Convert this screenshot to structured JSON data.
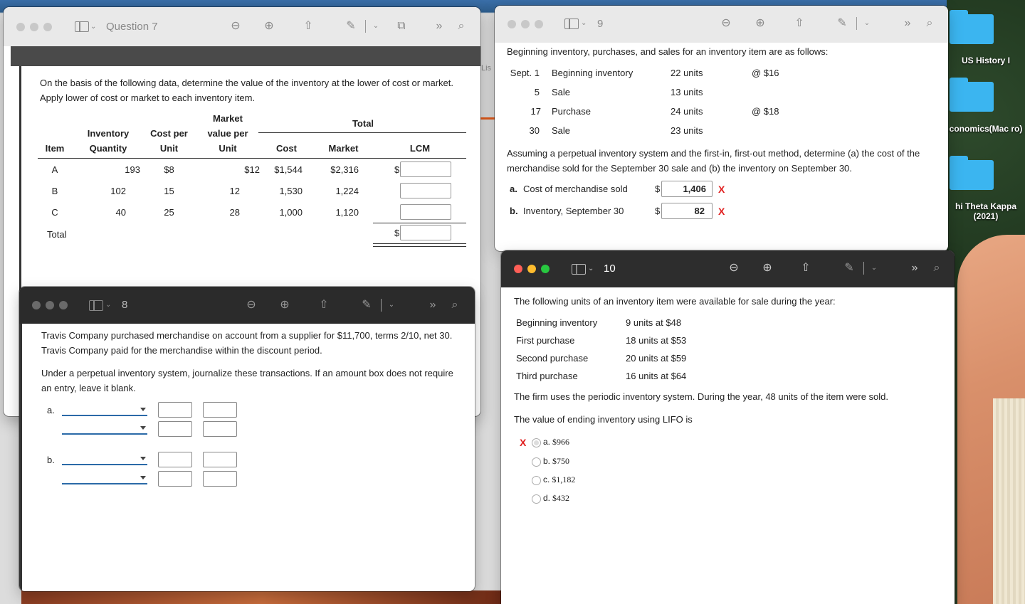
{
  "desktop": {
    "folders": [
      {
        "label": "US History I"
      },
      {
        "label": "conomics(Mac ro)"
      },
      {
        "label": "hi Theta Kappa (2021)"
      }
    ]
  },
  "partial_label": "Lis",
  "win7": {
    "title": "Question 7",
    "prompt": "On the basis of the following data, determine the value of the inventory at the lower of cost or market. Apply lower of cost or market to each inventory item.",
    "headers": {
      "market_top": "Market",
      "total": "Total",
      "inventory": "Inventory",
      "cost_per": "Cost per",
      "value_per": "value per",
      "item": "Item",
      "quantity": "Quantity",
      "unit": "Unit",
      "unit2": "Unit",
      "cost": "Cost",
      "market": "Market",
      "lcm": "LCM"
    },
    "rows": [
      {
        "item": "A",
        "qty": "193",
        "cost_per": "$8",
        "market_per": "$12",
        "cost": "$1,544",
        "market": "$2,316",
        "dollar": "$"
      },
      {
        "item": "B",
        "qty": "102",
        "cost_per": "15",
        "market_per": "12",
        "cost": "1,530",
        "market": "1,224",
        "dollar": ""
      },
      {
        "item": "C",
        "qty": "40",
        "cost_per": "25",
        "market_per": "28",
        "cost": "1,000",
        "market": "1,120",
        "dollar": ""
      }
    ],
    "total_label": "Total",
    "total_dollar": "$"
  },
  "win8": {
    "title": "8",
    "p1": "Travis Company purchased merchandise on account from a supplier for $11,700, terms 2/10, net 30. Travis Company paid for the merchandise within the discount period.",
    "p2": "Under a perpetual inventory system, journalize these transactions. If an amount box does not require an entry, leave it blank.",
    "label_a": "a.",
    "label_b": "b."
  },
  "win9": {
    "title": "9",
    "intro": "Beginning inventory, purchases, and sales for an inventory item are as follows:",
    "rows": [
      {
        "date": "Sept. 1",
        "desc": "Beginning inventory",
        "units": "22 units",
        "price": "@ $16"
      },
      {
        "date": "5",
        "desc": "Sale",
        "units": "13 units",
        "price": ""
      },
      {
        "date": "17",
        "desc": "Purchase",
        "units": "24 units",
        "price": "@ $18"
      },
      {
        "date": "30",
        "desc": "Sale",
        "units": "23 units",
        "price": ""
      }
    ],
    "question": "Assuming a perpetual inventory system and the first-in, first-out method, determine (a) the cost of the merchandise sold for the September 30 sale and (b) the inventory on September 30.",
    "a_label": "a.",
    "a_text": "Cost of merchandise sold",
    "a_value": "1,406",
    "b_label": "b.",
    "b_text": "Inventory, September 30",
    "b_value": "82",
    "dollar": "$",
    "wrong_mark": "X"
  },
  "win10": {
    "title": "10",
    "intro": "The following units of an inventory item were available for sale during the year:",
    "rows": [
      {
        "label": "Beginning inventory",
        "value": "9 units at $48"
      },
      {
        "label": "First purchase",
        "value": "18 units at $53"
      },
      {
        "label": "Second purchase",
        "value": "20 units at $59"
      },
      {
        "label": "Third purchase",
        "value": "16 units at $64"
      }
    ],
    "statement": "The firm uses the periodic inventory system. During the year, 48 units of the item were sold.",
    "question": "The value of ending inventory using LIFO is",
    "wrong_mark": "X",
    "options": [
      {
        "letter": "a.",
        "text": "$966",
        "selected": true
      },
      {
        "letter": "b.",
        "text": "$750",
        "selected": false
      },
      {
        "letter": "c.",
        "text": "$1,182",
        "selected": false
      },
      {
        "letter": "d.",
        "text": "$432",
        "selected": false
      }
    ]
  }
}
